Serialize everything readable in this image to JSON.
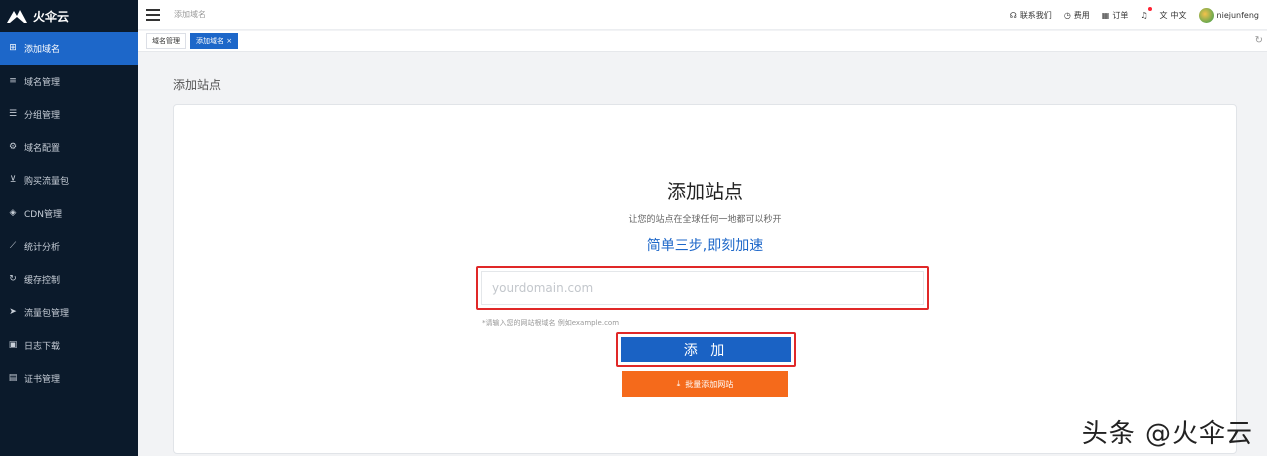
{
  "brand": {
    "name": "火伞云"
  },
  "sidebar": {
    "items": [
      {
        "label": "添加域名",
        "icon": "plus-square-icon",
        "active": true
      },
      {
        "label": "域名管理",
        "icon": "list-icon"
      },
      {
        "label": "分组管理",
        "icon": "group-list-icon"
      },
      {
        "label": "域名配置",
        "icon": "gear-icon"
      },
      {
        "label": "购买流量包",
        "icon": "cart-icon"
      },
      {
        "label": "CDN管理",
        "icon": "cdn-icon"
      },
      {
        "label": "统计分析",
        "icon": "chart-icon"
      },
      {
        "label": "缓存控制",
        "icon": "refresh-icon"
      },
      {
        "label": "流量包管理",
        "icon": "send-icon"
      },
      {
        "label": "日志下载",
        "icon": "download-icon"
      },
      {
        "label": "证书管理",
        "icon": "certificate-icon"
      }
    ]
  },
  "header": {
    "breadcrumb": "添加域名",
    "contact": "联系我们",
    "fees": "费用",
    "orders": "订单",
    "language": "中文",
    "username": "niejunfeng"
  },
  "tabs": [
    {
      "label": "域名管理",
      "active": false
    },
    {
      "label": "添加域名 ×",
      "active": true
    }
  ],
  "main": {
    "page_title": "添加站点",
    "hero_title": "添加站点",
    "hero_subtitle": "让您的站点在全球任何一地都可以秒开",
    "hero_tagline": "简单三步,即刻加速",
    "domain_placeholder": "yourdomain.com",
    "domain_value": "",
    "hint": "*请输入您的网站根域名 例如example.com",
    "add_label": "添 加",
    "bulk_label": "批量添加网站"
  },
  "watermark": "头条 @火伞云",
  "colors": {
    "sidebar_bg": "#0b1a2b",
    "accent": "#1d67c9",
    "highlight": "#e02828",
    "bulk_button": "#f56a1b"
  }
}
